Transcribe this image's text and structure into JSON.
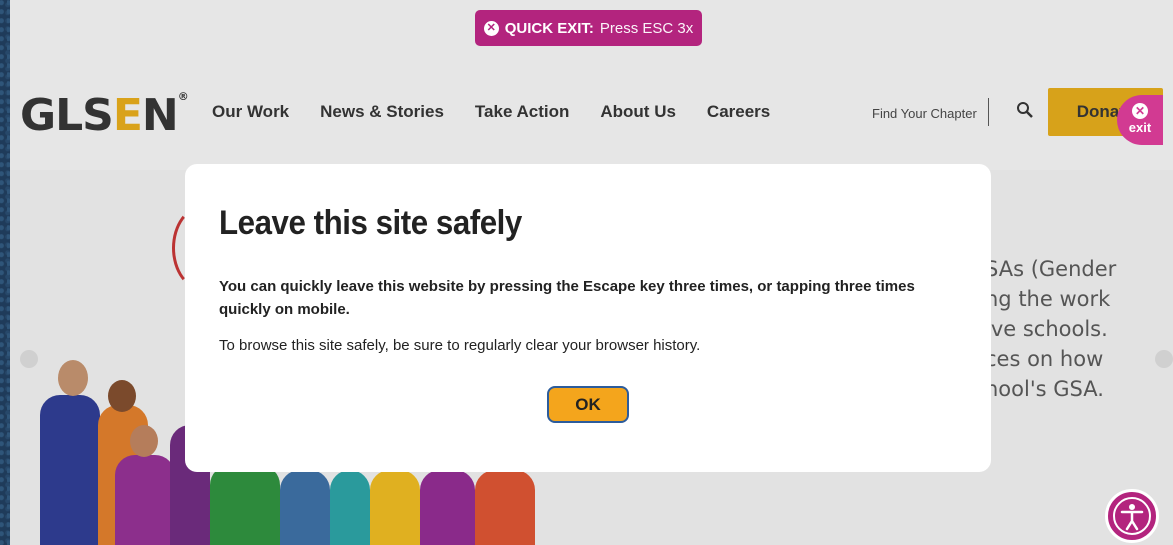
{
  "quick_exit": {
    "icon": "close-circle-icon",
    "strong": "QUICK EXIT:",
    "text": "Press ESC 3x"
  },
  "logo": {
    "text_a": "GLS",
    "text_b": "E",
    "text_c": "N",
    "reg": "®"
  },
  "nav": {
    "items": [
      "Our Work",
      "News & Stories",
      "Take Action",
      "About Us",
      "Careers"
    ]
  },
  "header": {
    "find_chapter": "Find Your Chapter",
    "donate": "Donate"
  },
  "exit_badge": {
    "label": "exit"
  },
  "hero": {
    "text": "SAs (Gender\nng the work\nive schools.\nces on how\nhool's GSA."
  },
  "modal": {
    "title": "Leave this site safely",
    "p1": "You can quickly leave this website by pressing the Escape key three times, or tapping three times quickly on mobile.",
    "p2": "To browse this site safely, be sure to regularly clear your browser history.",
    "ok": "OK"
  },
  "colors": {
    "brand_magenta": "#b3247e",
    "donate_gold": "#d7a21a",
    "ok_orange": "#f4a51c"
  }
}
